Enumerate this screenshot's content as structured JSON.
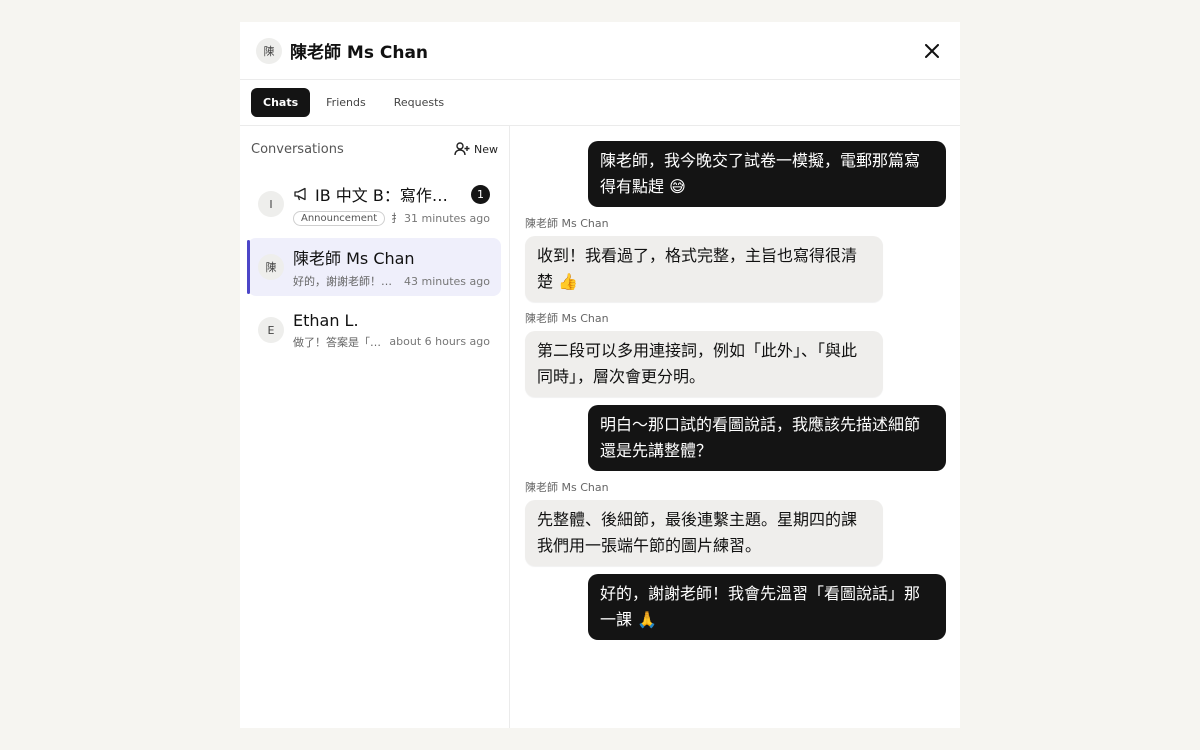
{
  "header": {
    "avatar_initial": "陳",
    "title": "陳老師 Ms Chan"
  },
  "tabs": [
    {
      "label": "Chats"
    },
    {
      "label": "Friends"
    },
    {
      "label": "Requests"
    }
  ],
  "sidebar": {
    "title": "Conversations",
    "new_label": "New",
    "conversations": [
      {
        "initial": "I",
        "name": "IB 中文 B：寫作…",
        "icon": "megaphone-icon",
        "unread": "1",
        "tag": "Announcement",
        "preview": "扌",
        "time": "31 minutes ago"
      },
      {
        "initial": "陳",
        "name": "陳老師 Ms Chan",
        "preview": "好的，謝謝老師！…",
        "time": "43 minutes ago"
      },
      {
        "initial": "E",
        "name": "Ethan L.",
        "preview": "做了！答案是「…",
        "time": "about 6 hours ago"
      }
    ]
  },
  "messages": [
    {
      "from": "me",
      "text": "陳老師，我今晚交了試卷一模擬，電郵那篇寫得有點趕 😅"
    },
    {
      "from": "them",
      "sender": "陳老師 Ms Chan",
      "text": "收到！我看過了，格式完整，主旨也寫得很清楚 👍"
    },
    {
      "from": "them",
      "sender": "陳老師 Ms Chan",
      "text": "第二段可以多用連接詞，例如「此外」、「與此同時」，層次會更分明。"
    },
    {
      "from": "me",
      "text": "明白～那口試的看圖說話，我應該先描述細節還是先講整體？"
    },
    {
      "from": "them",
      "sender": "陳老師 Ms Chan",
      "text": "先整體、後細節，最後連繫主題。星期四的課我們用一張端午節的圖片練習。"
    },
    {
      "from": "me",
      "text": "好的，謝謝老師！我會先溫習「看圖說話」那一課 🙏"
    }
  ]
}
